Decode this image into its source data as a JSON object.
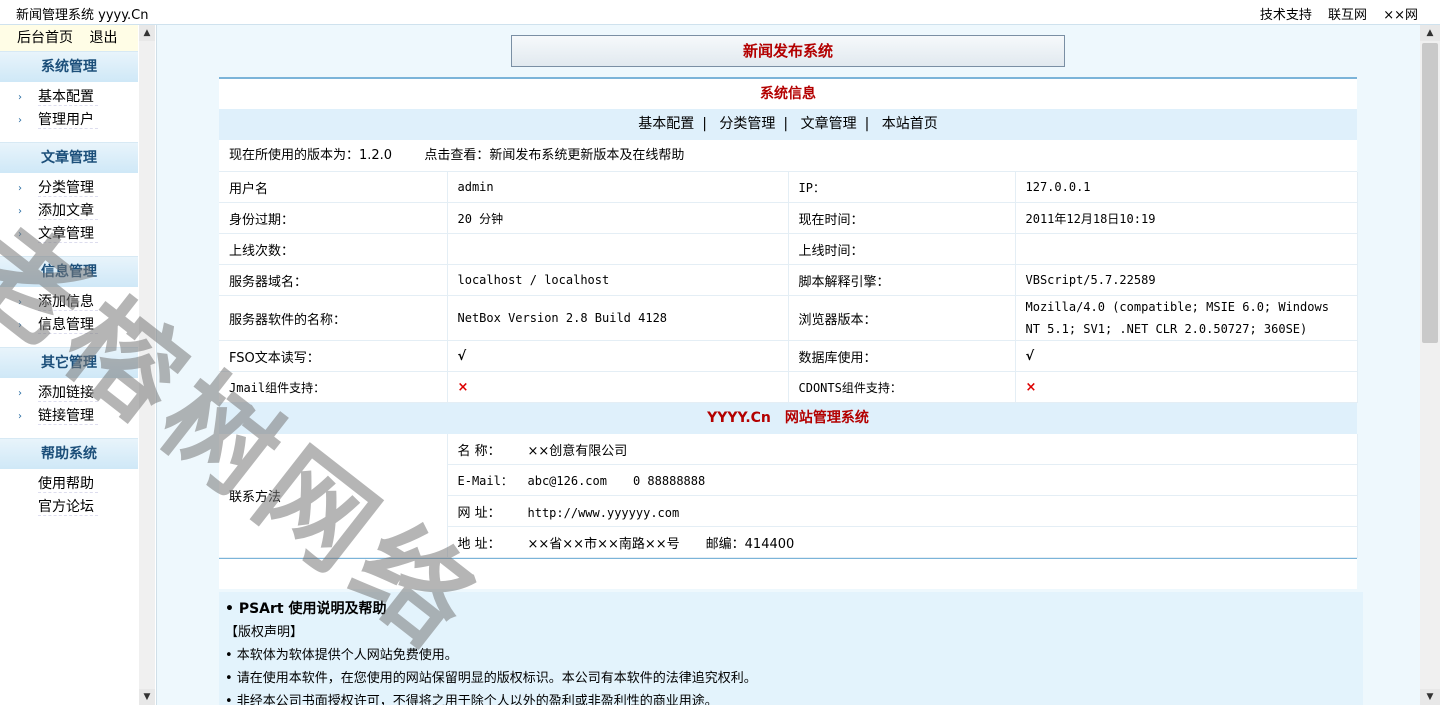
{
  "topbar": {
    "site_title": "新闻管理系统  yyyy.Cn",
    "links": [
      "技术支持",
      "联互网",
      "××网"
    ]
  },
  "sidebar": {
    "home": "后台首页",
    "logout": "退出",
    "groups": [
      {
        "title": "系统管理",
        "items": [
          "基本配置",
          "管理用户"
        ]
      },
      {
        "title": "文章管理",
        "items": [
          "分类管理",
          "添加文章",
          "文章管理"
        ]
      },
      {
        "title": "信息管理",
        "items": [
          "添加信息",
          "信息管理"
        ]
      },
      {
        "title": "其它管理",
        "items": [
          "添加链接",
          "链接管理"
        ]
      },
      {
        "title": "帮助系统",
        "items": [
          "使用帮助",
          "官方论坛"
        ]
      }
    ]
  },
  "main": {
    "system_title": "新闻发布系统",
    "panel_title": "系统信息",
    "nav": [
      "基本配置",
      "分类管理",
      "文章管理",
      "本站首页"
    ],
    "version_text": "现在所使用的版本为：1.2.0",
    "version_link": "点击查看：新闻发布系统更新版本及在线帮助",
    "info_rows": [
      [
        "用户名",
        "admin",
        "IP：",
        "127.0.0.1"
      ],
      [
        "身份过期：",
        "20 分钟",
        "现在时间：",
        "2011年12月18日10:19"
      ],
      [
        "上线次数：",
        "",
        "上线时间：",
        ""
      ],
      [
        "服务器域名：",
        "localhost / localhost",
        "脚本解释引擎：",
        "VBScript/5.7.22589"
      ],
      [
        "服务器软件的名称：",
        "NetBox Version 2.8 Build 4128",
        "浏览器版本：",
        "Mozilla/4.0 (compatible; MSIE 6.0; Windows NT 5.1; SV1; .NET CLR 2.0.50727; 360SE)"
      ],
      [
        "FSO文本读写：",
        "√",
        "数据库使用：",
        "√"
      ],
      [
        "Jmail组件支持：",
        "×",
        "CDONTS组件支持：",
        "×"
      ]
    ],
    "brand_a": "YYYY.Cn",
    "brand_b": "网站管理系统",
    "contact_label": "联系方法",
    "contact": {
      "name_k": "名  称：",
      "name_v": "××创意有限公司",
      "email_k": "E-Mail：",
      "email_v": "abc@126.com",
      "email_extra": "0  88888888",
      "web_k": "网  址：",
      "web_v": "http://www.yyyyyy.com",
      "addr_k": "地  址：",
      "addr_v": "××省××市××南路××号",
      "zip": "邮编：414400"
    },
    "help_title": "PSArt 使用说明及帮助",
    "help_lines": [
      "【版权声明】",
      "• 本软体为软体提供个人网站免费使用。",
      "• 请在使用本软件，在您使用的网站保留明显的版权标识。本公司有本软件的法律追究权利。",
      "• 非经本公司书面授权许可，不得将之用于除个人以外的盈利或非盈利性的商业用途。"
    ]
  },
  "watermark": "老榕树网络"
}
